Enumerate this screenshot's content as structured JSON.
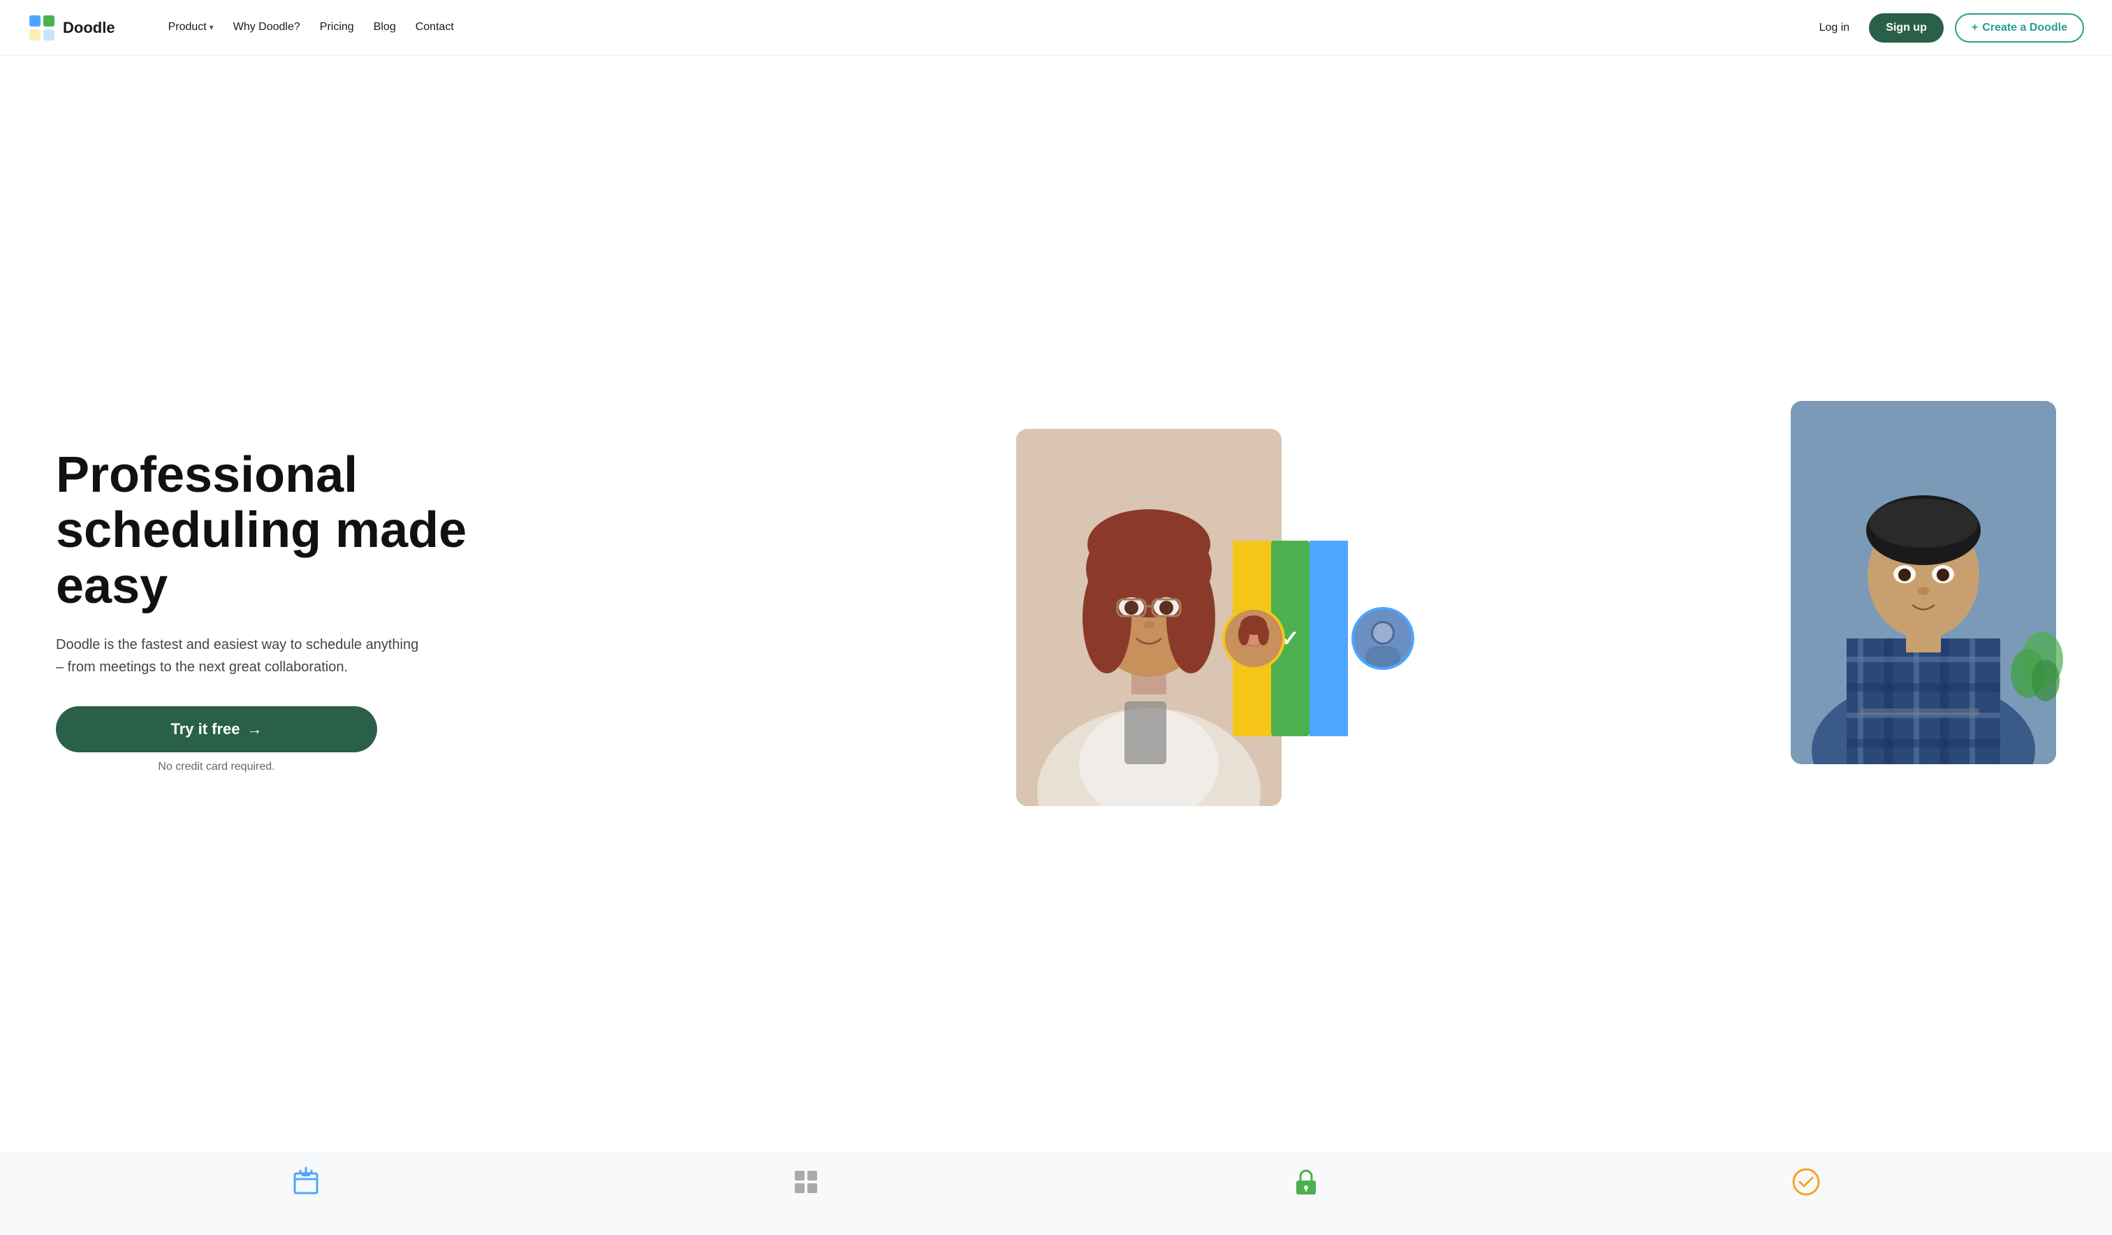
{
  "brand": {
    "name": "Doodle",
    "logo_alt": "Doodle logo"
  },
  "nav": {
    "links": [
      {
        "label": "Product",
        "has_dropdown": true,
        "id": "product"
      },
      {
        "label": "Why Doodle?",
        "has_dropdown": false,
        "id": "why-doodle"
      },
      {
        "label": "Pricing",
        "has_dropdown": false,
        "id": "pricing"
      },
      {
        "label": "Blog",
        "has_dropdown": false,
        "id": "blog"
      },
      {
        "label": "Contact",
        "has_dropdown": false,
        "id": "contact"
      }
    ],
    "login_label": "Log in",
    "signup_label": "Sign up",
    "create_doodle_label": "Create a Doodle",
    "create_doodle_icon": "+"
  },
  "hero": {
    "title": "Professional scheduling made easy",
    "description": "Doodle is the fastest and easiest way to schedule anything – from meetings to the next great collaboration.",
    "cta_label": "Try it free",
    "cta_arrow": "→",
    "sub_label": "No credit card required."
  },
  "colors": {
    "brand_green": "#2a6049",
    "brand_teal": "#2a9d8f",
    "bar_yellow": "#f5c518",
    "bar_green": "#4caf50",
    "bar_blue": "#4da6ff",
    "avatar_border_yellow": "#f5c518",
    "avatar_border_blue": "#4da6ff"
  },
  "bottom_icons": [
    {
      "id": "calendar-icon",
      "color": "#4da6ff"
    },
    {
      "id": "grid-icon",
      "color": "#888"
    },
    {
      "id": "lock-icon",
      "color": "#4caf50"
    },
    {
      "id": "check-circle-icon",
      "color": "#f5a623"
    }
  ]
}
